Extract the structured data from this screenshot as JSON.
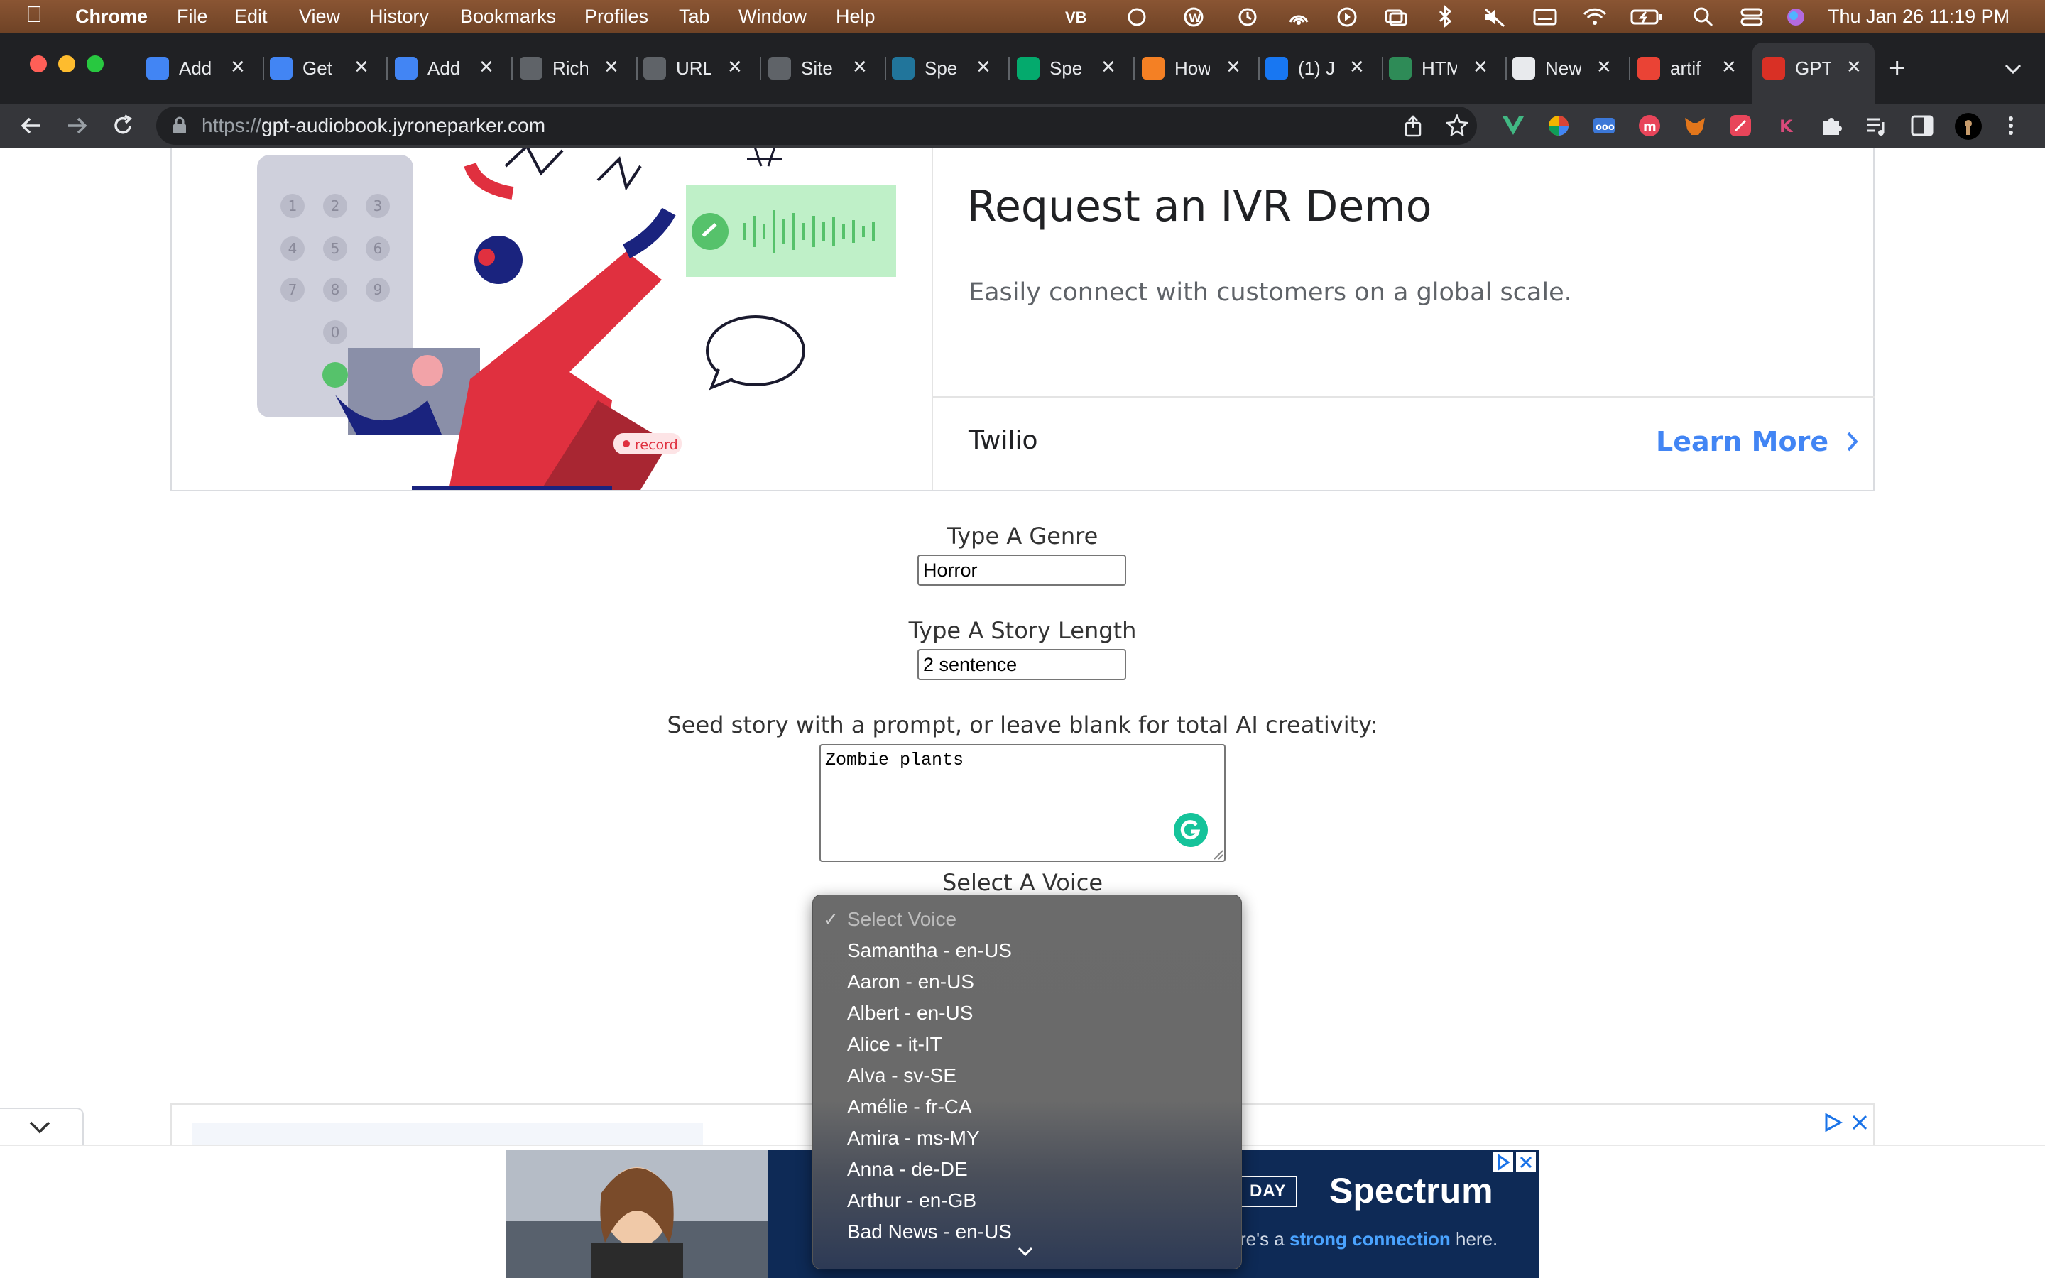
{
  "menubar": {
    "app": "Chrome",
    "items": [
      "File",
      "Edit",
      "View",
      "History",
      "Bookmarks",
      "Profiles",
      "Tab",
      "Window",
      "Help"
    ],
    "status_vb": "VB",
    "datetime": "Thu Jan 26  11:19 PM"
  },
  "tabs": [
    {
      "label": "Add",
      "color": "#4285f4"
    },
    {
      "label": "Get",
      "color": "#4285f4"
    },
    {
      "label": "Add",
      "color": "#4285f4"
    },
    {
      "label": "Rich",
      "color": "#5f6368"
    },
    {
      "label": "URL",
      "color": "#5f6368"
    },
    {
      "label": "Site",
      "color": "#5f6368"
    },
    {
      "label": "Spe",
      "color": "#21759b"
    },
    {
      "label": "Spe",
      "color": "#04aa6d"
    },
    {
      "label": "How",
      "color": "#f48024"
    },
    {
      "label": "(1) J",
      "color": "#1877f2"
    },
    {
      "label": "HTM",
      "color": "#2e8b57"
    },
    {
      "label": "New",
      "color": "#e8eaed"
    },
    {
      "label": "artif",
      "color": "#ea4335"
    },
    {
      "label": "GPT",
      "color": "#d93025"
    }
  ],
  "toolbar": {
    "url_scheme": "https://",
    "url_host": "gpt-audiobook.jyroneparker.com"
  },
  "ad_top": {
    "title": "Request an IVR Demo",
    "subtitle": "Easily connect with customers on a global scale.",
    "brand": "Twilio",
    "cta": "Learn More",
    "record_badge": "record",
    "keypad": [
      "1",
      "2",
      "3",
      "4",
      "5",
      "6",
      "7",
      "8",
      "9",
      "0"
    ]
  },
  "form": {
    "genre_label": "Type A Genre",
    "genre_value": "Horror",
    "length_label": "Type A Story Length",
    "length_value": "2 sentence",
    "prompt_label": "Seed story with a prompt, or leave blank for total AI creativity:",
    "prompt_value": "Zombie plants",
    "voice_label": "Select A Voice"
  },
  "voice_dropdown": {
    "selected": "Select Voice",
    "options": [
      "Samantha - en-US",
      "Aaron - en-US",
      "Albert - en-US",
      "Alice - it-IT",
      "Alva - sv-SE",
      "Amélie - fr-CA",
      "Amira - ms-MY",
      "Anna - de-DE",
      "Arthur - en-GB",
      "Bad News - en-US"
    ]
  },
  "ad_bottom": {
    "brand": "Spectrum",
    "today_badge": "DAY",
    "tagline_prefix": "re's a ",
    "tagline_bold": "strong connection",
    "tagline_suffix": " here."
  }
}
